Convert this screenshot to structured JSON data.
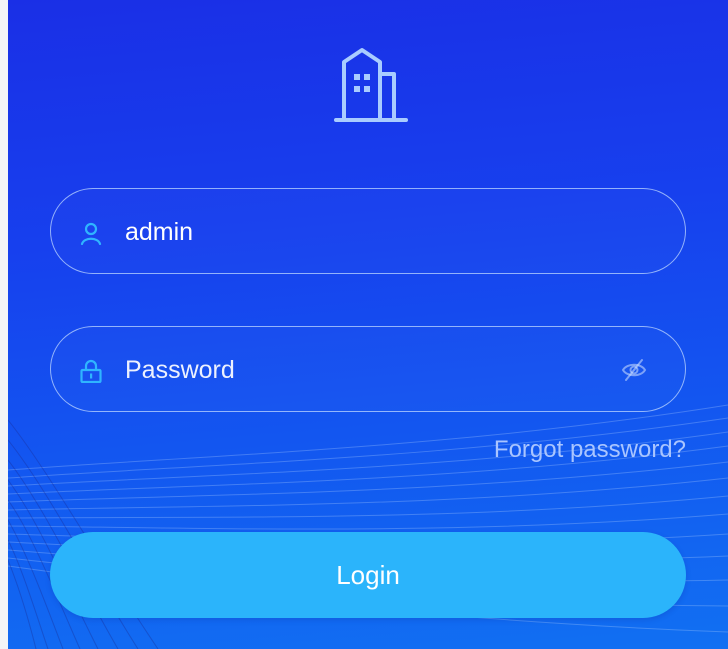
{
  "icons": {
    "logo": "building-icon",
    "username": "user-icon",
    "password": "lock-icon",
    "toggle_visibility": "eye-off-icon"
  },
  "colors": {
    "background_top": "#1a2fe6",
    "background_bottom": "#1170f2",
    "field_border": "#bed7ff",
    "icon_accent": "#2fb5ff",
    "button": "#2bb4fb",
    "link": "#a9c5ff"
  },
  "login_form": {
    "username": {
      "value": "admin",
      "placeholder": ""
    },
    "password": {
      "value": "",
      "placeholder": "Password"
    },
    "forgot_password_label": "Forgot password?",
    "login_button_label": "Login"
  }
}
